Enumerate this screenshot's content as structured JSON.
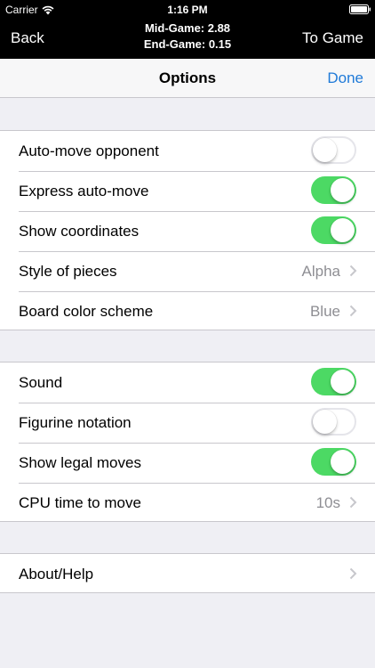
{
  "status_bar": {
    "carrier": "Carrier",
    "time": "1:16 PM"
  },
  "game_nav": {
    "back_label": "Back",
    "mid_game": "Mid-Game: 2.88",
    "end_game": "End-Game: 0.15",
    "to_game_label": "To Game"
  },
  "options_nav": {
    "title": "Options",
    "done_label": "Done",
    "accent_color": "#1f7ad8"
  },
  "group1": {
    "rows": [
      {
        "label": "Auto-move opponent",
        "type": "switch",
        "on": false
      },
      {
        "label": "Express auto-move",
        "type": "switch",
        "on": true
      },
      {
        "label": "Show coordinates",
        "type": "switch",
        "on": true
      },
      {
        "label": "Style of pieces",
        "type": "detail",
        "value": "Alpha"
      },
      {
        "label": "Board color scheme",
        "type": "detail",
        "value": "Blue"
      }
    ]
  },
  "group2": {
    "rows": [
      {
        "label": "Sound",
        "type": "switch",
        "on": true
      },
      {
        "label": "Figurine notation",
        "type": "switch",
        "on": false
      },
      {
        "label": "Show legal moves",
        "type": "switch",
        "on": true
      },
      {
        "label": "CPU time to move",
        "type": "detail",
        "value": "10s"
      }
    ]
  },
  "group3": {
    "rows": [
      {
        "label": "About/Help",
        "type": "detail",
        "value": ""
      }
    ]
  },
  "colors": {
    "switch_on": "#4cd964",
    "background": "#efeff4"
  }
}
